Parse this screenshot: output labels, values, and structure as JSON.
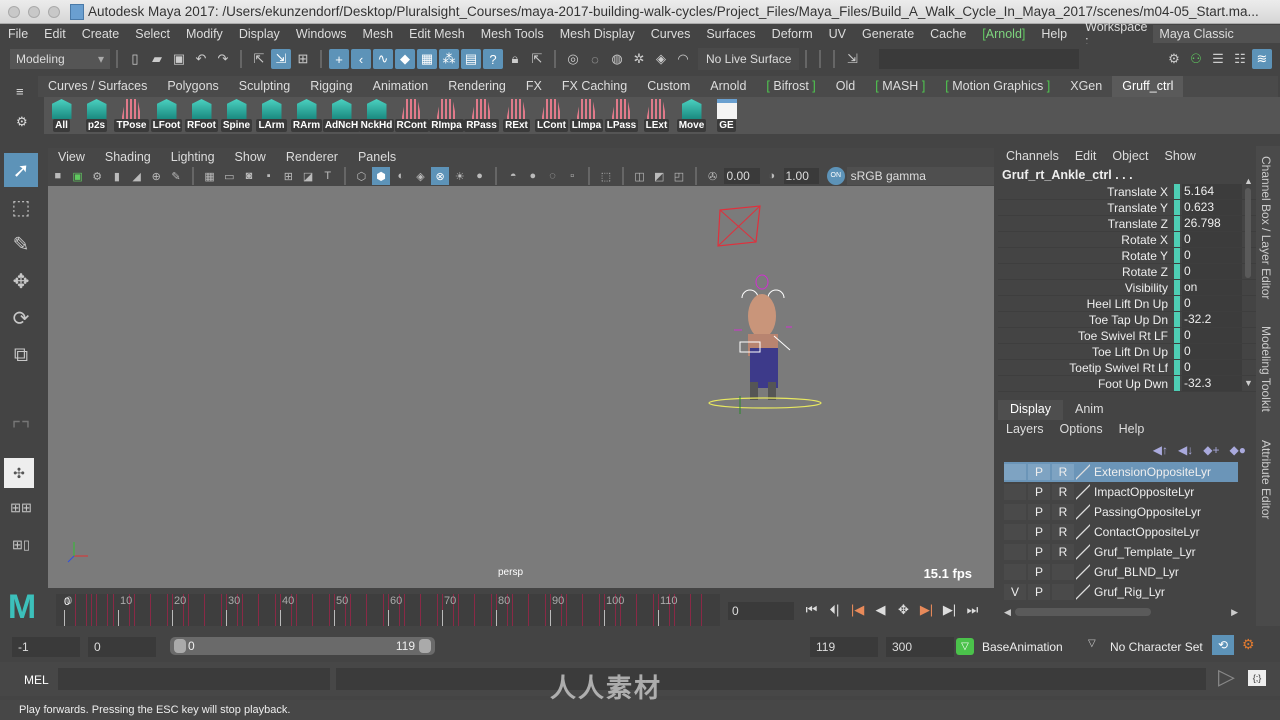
{
  "window": {
    "title": "Autodesk Maya 2017: /Users/ekunzendorf/Desktop/Pluralsight_Courses/maya-2017-building-walk-cycles/Project_Files/Maya_Files/Build_A_Walk_Cycle_In_Maya_2017/scenes/m04-05_Start.ma..."
  },
  "menubar": {
    "items": [
      "File",
      "Edit",
      "Create",
      "Select",
      "Modify",
      "Display",
      "Windows",
      "Mesh",
      "Edit Mesh",
      "Mesh Tools",
      "Mesh Display",
      "Curves",
      "Surfaces",
      "Deform",
      "UV",
      "Generate",
      "Cache"
    ],
    "arnold": "Arnold",
    "help": "Help",
    "workspace_label": "Workspace :",
    "workspace_value": "Maya Classic"
  },
  "statusline": {
    "mode": "Modeling",
    "live_surface": "No Live Surface"
  },
  "shelf": {
    "tabs": [
      "Curves / Surfaces",
      "Polygons",
      "Sculpting",
      "Rigging",
      "Animation",
      "Rendering",
      "FX",
      "FX Caching",
      "Custom",
      "Arnold",
      "Bifrost",
      "Old",
      "MASH",
      "Motion Graphics",
      "XGen",
      "Gruff_ctrl"
    ],
    "active_tab": "Gruff_ctrl",
    "buttons": [
      {
        "label": "All",
        "icon": "teal"
      },
      {
        "label": "p2s",
        "icon": "teal"
      },
      {
        "label": "TPose",
        "icon": "red"
      },
      {
        "label": "LFoot",
        "icon": "teal"
      },
      {
        "label": "RFoot",
        "icon": "teal"
      },
      {
        "label": "Spine",
        "icon": "teal"
      },
      {
        "label": "LArm",
        "icon": "teal"
      },
      {
        "label": "RArm",
        "icon": "teal"
      },
      {
        "label": "AdNcH",
        "icon": "teal"
      },
      {
        "label": "NckHd",
        "icon": "teal"
      },
      {
        "label": "RCont",
        "icon": "red"
      },
      {
        "label": "RImpa",
        "icon": "red"
      },
      {
        "label": "RPass",
        "icon": "red"
      },
      {
        "label": "RExt",
        "icon": "red"
      },
      {
        "label": "LCont",
        "icon": "red"
      },
      {
        "label": "LImpa",
        "icon": "red"
      },
      {
        "label": "LPass",
        "icon": "red"
      },
      {
        "label": "LExt",
        "icon": "red"
      },
      {
        "label": "Move",
        "icon": "teal"
      },
      {
        "label": "GE",
        "icon": "ge"
      }
    ]
  },
  "panel": {
    "menu": [
      "View",
      "Shading",
      "Lighting",
      "Show",
      "Renderer",
      "Panels"
    ],
    "exposure": "0.00",
    "gamma": "1.00",
    "gamma_toggle": "ON",
    "color_space": "sRGB gamma",
    "camera": "persp",
    "fps": "15.1 fps"
  },
  "timeline": {
    "ticks": [
      "0",
      "10",
      "20",
      "30",
      "40",
      "50",
      "60",
      "70",
      "80",
      "90",
      "100",
      "110"
    ],
    "current_frame_marker": "0",
    "current_frame": "0",
    "keys": [
      2,
      4,
      5,
      6,
      8,
      9,
      12,
      13,
      16,
      19,
      20,
      22,
      23,
      26,
      29,
      30,
      32,
      33,
      36,
      39,
      40,
      42,
      43,
      46,
      49,
      50,
      52,
      53,
      56,
      59,
      60,
      62,
      63,
      66,
      69,
      70,
      72,
      73,
      76,
      79,
      80,
      82,
      83,
      86,
      89,
      90,
      92,
      93,
      96,
      99,
      100,
      102,
      103,
      106,
      109,
      110,
      112,
      113,
      116,
      118
    ]
  },
  "playback": {
    "buttons": [
      "go-to-start",
      "step-back-frame",
      "step-back-key",
      "play-backwards",
      "play-forwards",
      "step-forward-key",
      "step-forward-frame",
      "go-to-end"
    ]
  },
  "range": {
    "anim_start": "-1",
    "playback_start": "0",
    "slider_start": "0",
    "slider_end": "119",
    "playback_end": "119",
    "anim_end": "300",
    "anim_layer": "BaseAnimation",
    "character_set": "No Character Set"
  },
  "cmdline": {
    "language": "MEL",
    "input": "",
    "result": ""
  },
  "helpline": "Play forwards. Pressing the ESC key will stop playback.",
  "channelbox": {
    "menu": [
      "Channels",
      "Edit",
      "Object",
      "Show"
    ],
    "object": "Gruf_rt_Ankle_ctrl . . .",
    "channels": [
      {
        "name": "Translate X",
        "value": "5.164"
      },
      {
        "name": "Translate Y",
        "value": "0.623"
      },
      {
        "name": "Translate Z",
        "value": "26.798"
      },
      {
        "name": "Rotate X",
        "value": "0"
      },
      {
        "name": "Rotate Y",
        "value": "0"
      },
      {
        "name": "Rotate Z",
        "value": "0"
      },
      {
        "name": "Visibility",
        "value": "on"
      },
      {
        "name": "Heel Lift Dn Up",
        "value": "0"
      },
      {
        "name": "Toe Tap Up Dn",
        "value": "-32.2"
      },
      {
        "name": "Toe Swivel Rt LF",
        "value": "0"
      },
      {
        "name": "Toe Lift Dn Up",
        "value": "0"
      },
      {
        "name": "Toetip Swivel Rt Lf",
        "value": "0"
      },
      {
        "name": "Foot Up Dwn",
        "value": "-32.3"
      }
    ]
  },
  "layereditor": {
    "tabs": [
      "Display",
      "Anim"
    ],
    "active_tab": "Display",
    "menu": [
      "Layers",
      "Options",
      "Help"
    ],
    "layers": [
      {
        "v": "",
        "p": "P",
        "r": "R",
        "name": "ExtensionOppositeLyr",
        "selected": true
      },
      {
        "v": "",
        "p": "P",
        "r": "R",
        "name": "ImpactOppositeLyr",
        "selected": false
      },
      {
        "v": "",
        "p": "P",
        "r": "R",
        "name": "PassingOppositeLyr",
        "selected": false
      },
      {
        "v": "",
        "p": "P",
        "r": "R",
        "name": "ContactOppositeLyr",
        "selected": false
      },
      {
        "v": "",
        "p": "P",
        "r": "R",
        "name": "Gruf_Template_Lyr",
        "selected": false
      },
      {
        "v": "",
        "p": "P",
        "r": "",
        "name": "Gruf_BLND_Lyr",
        "selected": false
      },
      {
        "v": "V",
        "p": "P",
        "r": "",
        "name": "Gruf_Rig_Lyr",
        "selected": false
      }
    ]
  },
  "side_tabs": [
    "Channel Box / Layer Editor",
    "Modeling Toolkit",
    "Attribute Editor"
  ],
  "watermark": "人人素材",
  "colors": {
    "accent": "#5d93b8",
    "channel_key": "#4ecdb4",
    "timeline_key": "#8a2946",
    "arnold": "#4fc94f"
  }
}
